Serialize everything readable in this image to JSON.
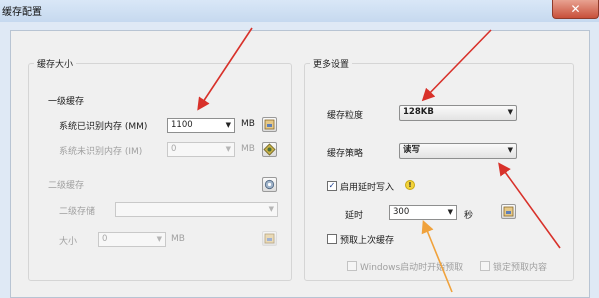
{
  "window": {
    "title": "缓存配置",
    "close_label": "✕"
  },
  "cache_size": {
    "title": "缓存大小",
    "level1_label": "一级缓存",
    "identified_mem_label": "系统已识别内存 (MM)",
    "identified_mem_value": "1100",
    "identified_mem_unit": "MB",
    "unidentified_mem_label": "系统未识别内存 (IM)",
    "unidentified_mem_value": "0",
    "unidentified_mem_unit": "MB",
    "level2_label": "二级缓存",
    "level2_storage_label": "二级存储",
    "level2_storage_value": "",
    "size_label": "大小",
    "size_value": "0",
    "size_unit": "MB"
  },
  "more_settings": {
    "title": "更多设置",
    "granularity_label": "缓存粒度",
    "granularity_value": "128KB",
    "strategy_label": "缓存策略",
    "strategy_value": "读写",
    "delay_write_label": "启用延时写入",
    "delay_write_checked": true,
    "delay_label": "延时",
    "delay_value": "300",
    "delay_unit": "秒",
    "prefetch_label": "预取上次缓存",
    "prefetch_checked": false,
    "windows_prefetch_label": "Windows启动时开始预取",
    "lock_prefetch_label": "锁定预取内容"
  },
  "colors": {
    "annotation_arrow": "#d8312a"
  }
}
